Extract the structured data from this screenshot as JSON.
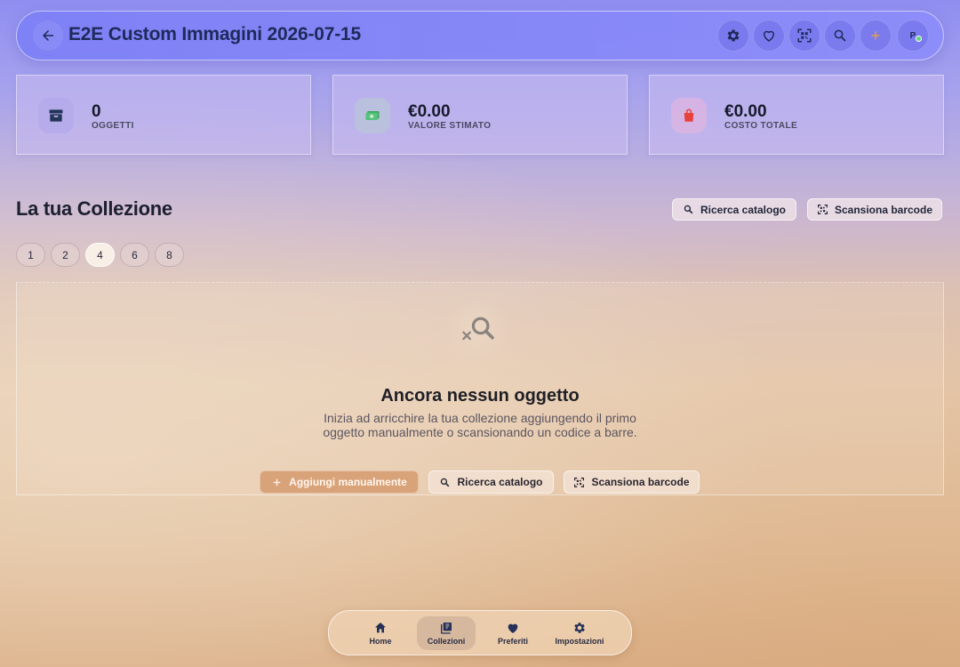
{
  "header": {
    "title": "E2E Custom Immagini 2026-07-15",
    "back_icon": "arrow-left-icon",
    "avatar_initial": "P"
  },
  "stats": [
    {
      "value": "0",
      "label": "OGGETTI",
      "icon": "archive-box-icon",
      "color": "#243658"
    },
    {
      "value": "€0.00",
      "label": "VALORE STIMATO",
      "icon": "money-icon",
      "color": "#46b36a"
    },
    {
      "value": "€0.00",
      "label": "COSTO TOTALE",
      "icon": "shopping-bag-icon",
      "color": "#e8423c"
    }
  ],
  "section": {
    "title": "La tua Collezione",
    "search_catalog_label": "Ricerca catalogo",
    "scan_barcode_label": "Scansiona barcode"
  },
  "grid_options": {
    "values": [
      "1",
      "2",
      "4",
      "6",
      "8"
    ],
    "selected": "4"
  },
  "empty_state": {
    "title": "Ancora nessun oggetto",
    "text": "Inizia ad arricchire la tua collezione aggiungendo il primo oggetto manualmente o scansionando un codice a barre.",
    "add_manual_label": "Aggiungi manualmente",
    "search_catalog_label": "Ricerca catalogo",
    "scan_barcode_label": "Scansiona barcode"
  },
  "bottom_nav": {
    "items": [
      {
        "label": "Home",
        "icon": "home-icon"
      },
      {
        "label": "Collezioni",
        "icon": "collections-icon"
      },
      {
        "label": "Preferiti",
        "icon": "heart-icon"
      },
      {
        "label": "Impostazioni",
        "icon": "gear-icon"
      }
    ],
    "active": "Collezioni"
  },
  "colors": {
    "accent": "#7b7ef2",
    "primary_button": "#d9a37a"
  }
}
